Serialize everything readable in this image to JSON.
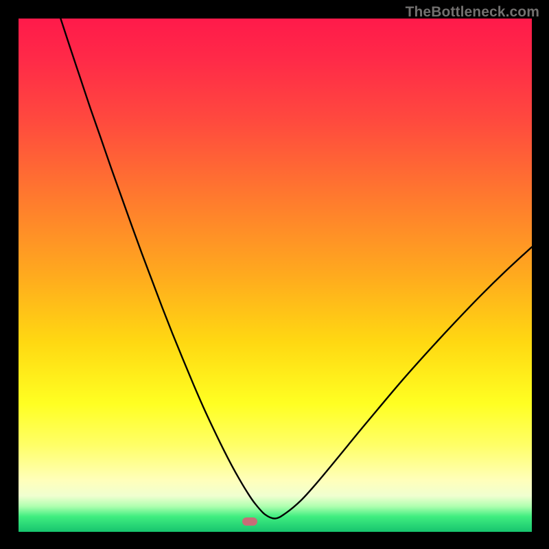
{
  "watermark": "TheBottleneck.com",
  "chart_data": {
    "type": "line",
    "title": "",
    "xlabel": "",
    "ylabel": "",
    "xlim": [
      0,
      100
    ],
    "ylim": [
      0,
      100
    ],
    "series": [
      {
        "name": "curve",
        "x": [
          8.2,
          10,
          12,
          14,
          16,
          18,
          20,
          22,
          24,
          26,
          28,
          30,
          32,
          34,
          36,
          38,
          40,
          41.5,
          43,
          44.5,
          46,
          48,
          50,
          52,
          55,
          58,
          62,
          66,
          70,
          75,
          80,
          85,
          90,
          95,
          100
        ],
        "y": [
          100,
          94.5,
          88.5,
          82.5,
          76.8,
          71,
          65.4,
          59.8,
          54.3,
          49,
          43.7,
          38.6,
          33.7,
          28.9,
          24.3,
          20,
          15.9,
          13,
          10.3,
          7.8,
          5.6,
          3.4,
          2.6,
          3.6,
          6.1,
          9.4,
          14.2,
          19.1,
          23.9,
          29.8,
          35.4,
          40.8,
          46.0,
          50.9,
          55.5
        ]
      }
    ],
    "marker": {
      "x": 45,
      "y": 2.05
    },
    "colors": {
      "curve": "#000000",
      "marker": "#c76d77",
      "background_top": "#ff1a4a",
      "background_bottom": "#17c46e"
    }
  }
}
